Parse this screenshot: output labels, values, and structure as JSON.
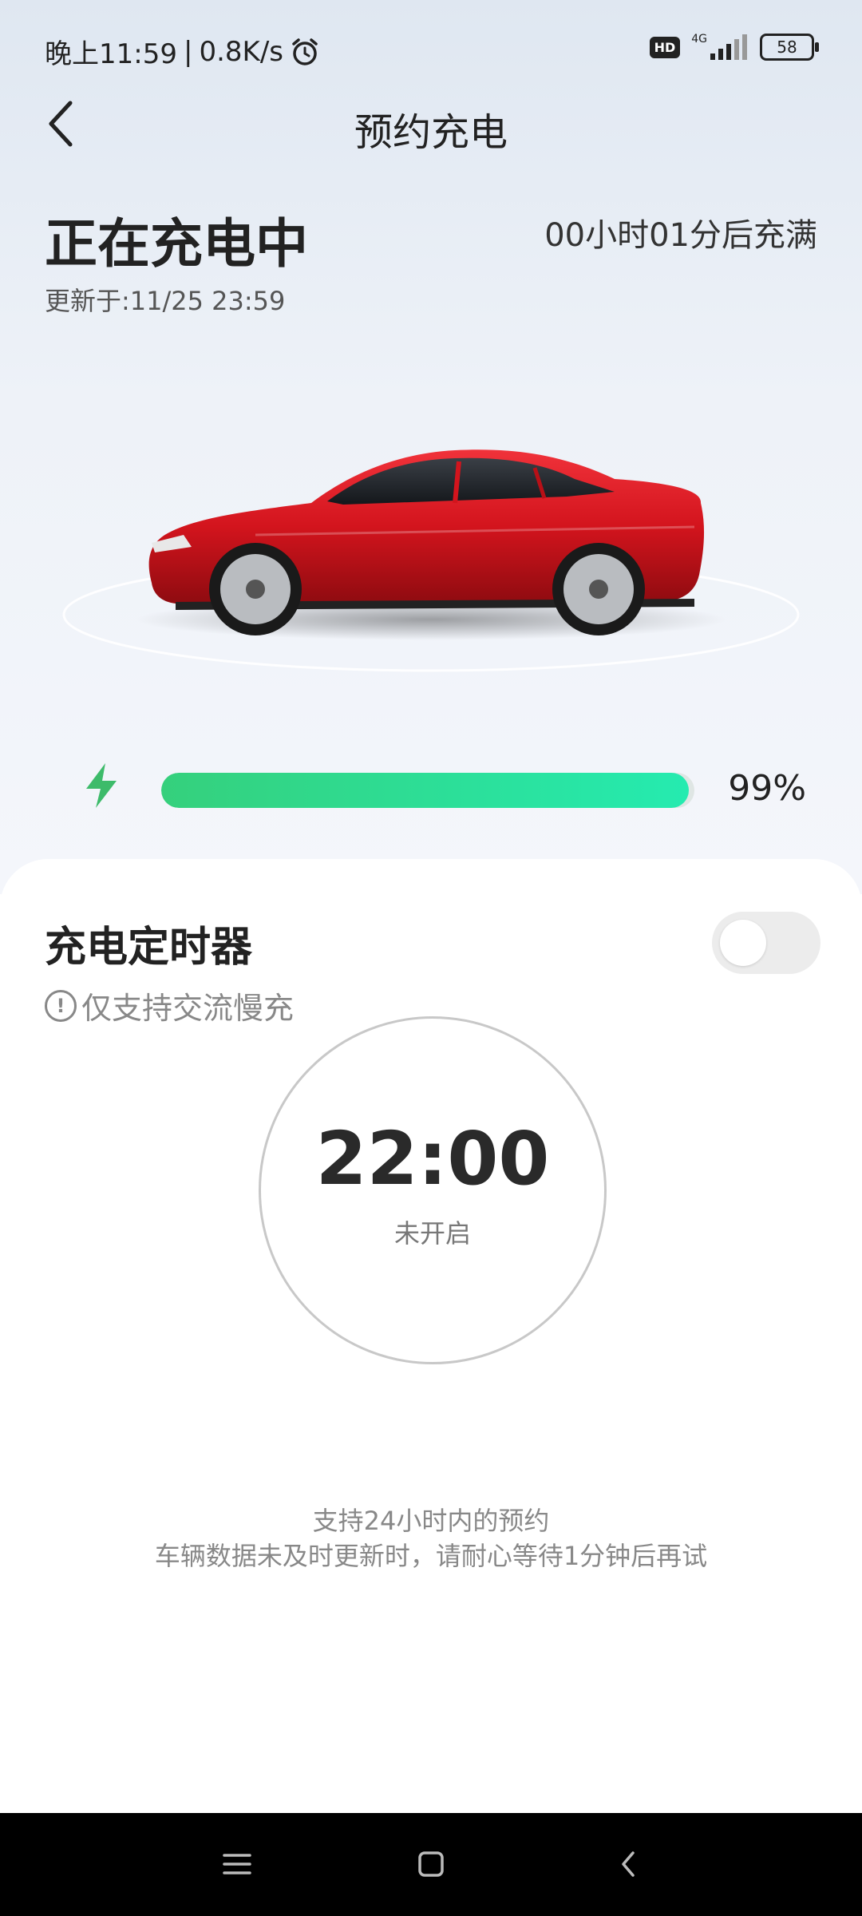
{
  "status_bar": {
    "time": "晚上11:59",
    "network_speed": "0.8K/s",
    "hd": "HD",
    "network_type": "4G",
    "battery": "58"
  },
  "header": {
    "title": "预约充电"
  },
  "charging": {
    "status": "正在充电中",
    "time_to_full": "00小时01分后充满",
    "updated": "更新于:11/25 23:59",
    "percent_label": "99%",
    "percent": 99
  },
  "timer": {
    "title": "充电定时器",
    "note": "仅支持交流慢充",
    "enabled": false,
    "time": "22:00",
    "state": "未开启"
  },
  "hints": {
    "line1": "支持24小时内的预约",
    "line2": "车辆数据未及时更新时，请耐心等待1分钟后再试"
  },
  "colors": {
    "accent_green": "#2fd88f",
    "car_red": "#d3141d"
  }
}
